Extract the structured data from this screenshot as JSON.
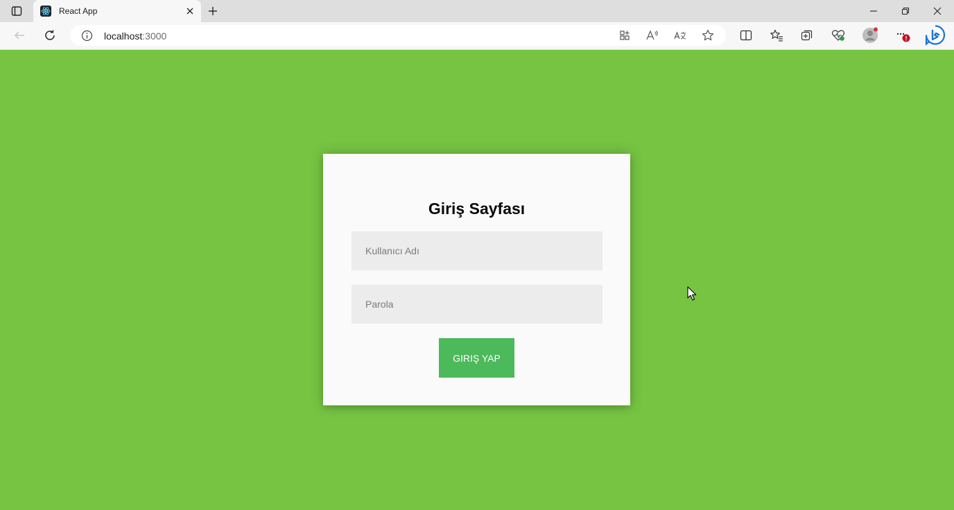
{
  "browser": {
    "tab": {
      "title": "React App"
    },
    "address_bar": {
      "host": "localhost",
      "port": ":3000"
    }
  },
  "login": {
    "title": "Giriş Sayfası",
    "username_placeholder": "Kullanıcı Adı",
    "password_placeholder": "Parola",
    "submit_label": "GIRIŞ YAP"
  },
  "colors": {
    "page_background": "#76c442",
    "submit_button": "#4cb95a",
    "card_background": "#fafafa"
  }
}
